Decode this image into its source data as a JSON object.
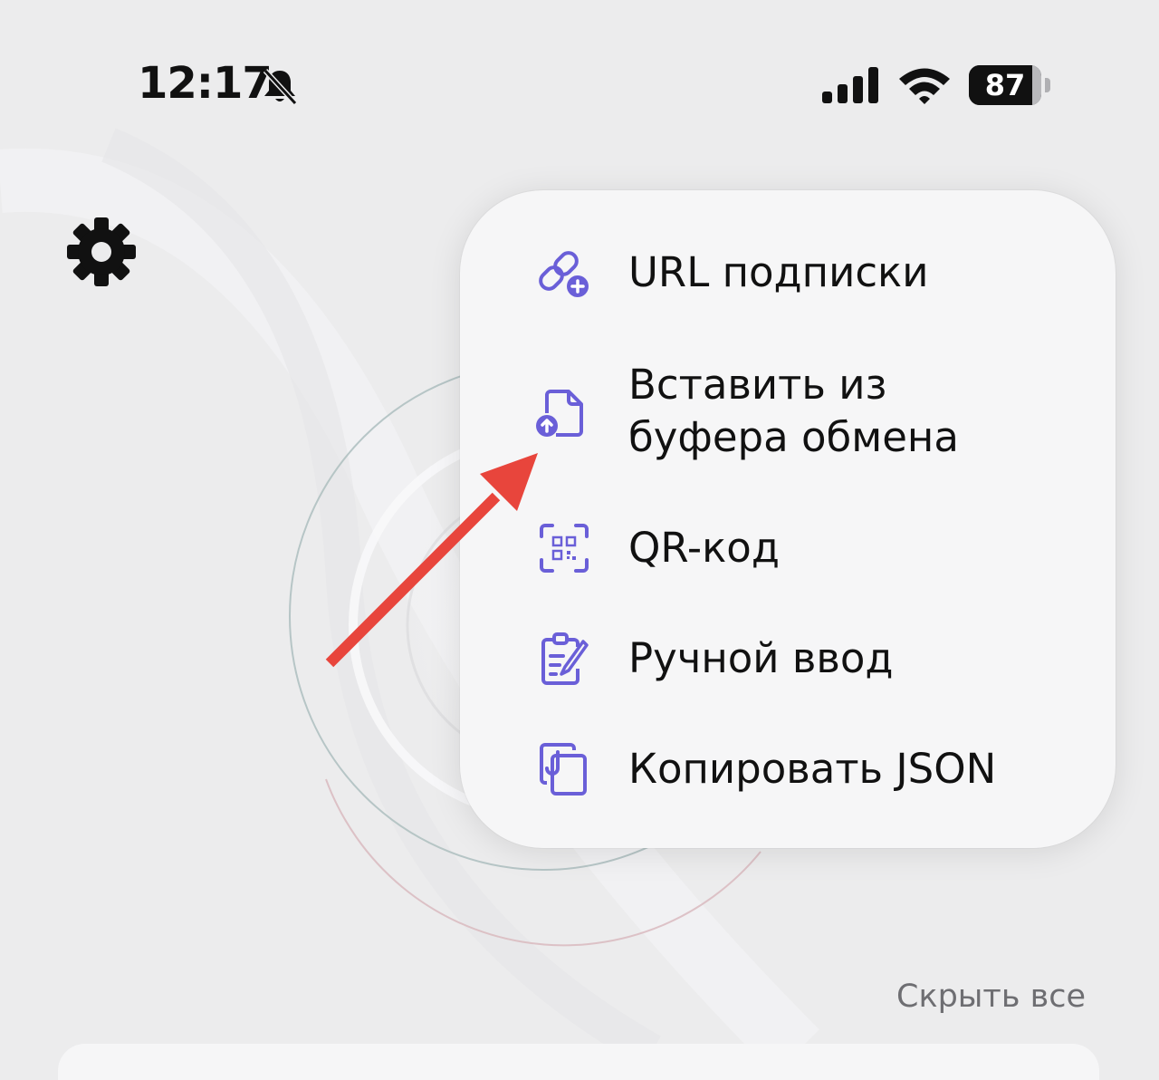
{
  "status_bar": {
    "time": "12:17",
    "battery_percent": "87",
    "battery_level": 0.87,
    "icons": [
      "bell-slash-icon",
      "cellular-signal-icon",
      "wifi-icon",
      "battery-icon"
    ]
  },
  "header": {
    "settings_icon": "gear-icon"
  },
  "menu": {
    "items": [
      {
        "label": "URL подписки",
        "icon": "link-add-icon"
      },
      {
        "label": "Вставить из\nбуфера обмена",
        "icon": "paste-file-icon"
      },
      {
        "label": "QR-код",
        "icon": "qr-scan-icon"
      },
      {
        "label": "Ручной ввод",
        "icon": "clipboard-edit-icon"
      },
      {
        "label": "Копировать JSON",
        "icon": "copy-json-icon"
      }
    ]
  },
  "footer": {
    "hide_all_label": "Скрыть все"
  },
  "colors": {
    "accent": "#6a5fd8",
    "annotation_arrow": "#e8453c",
    "background": "#ececed"
  }
}
